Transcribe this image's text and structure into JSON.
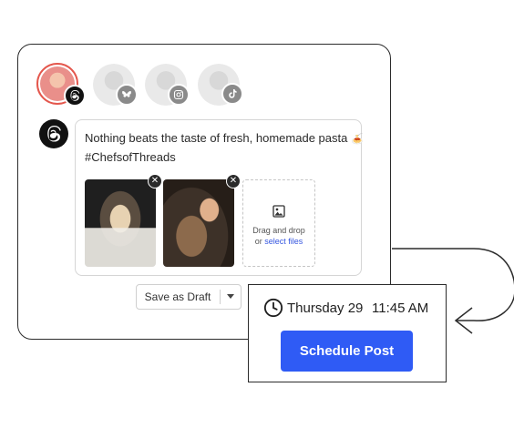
{
  "accounts": [
    {
      "platform": "threads",
      "badge_icon": "threads-icon",
      "selected": true
    },
    {
      "platform": "bluesky",
      "badge_icon": "butterfly-icon",
      "selected": false
    },
    {
      "platform": "instagram",
      "badge_icon": "instagram-icon",
      "selected": false
    },
    {
      "platform": "tiktok",
      "badge_icon": "tiktok-icon",
      "selected": false
    }
  ],
  "composer": {
    "channel_icon": "threads-icon",
    "text_line1": "Nothing beats the taste of fresh, homemade pasta",
    "emoji": "🍝",
    "text_line2": "#ChefsofThreads",
    "attachments": [
      {
        "name": "pasta-hands-photo"
      },
      {
        "name": "pasta-making-photo"
      }
    ],
    "dropzone_line1": "Drag and drop",
    "dropzone_or": "or",
    "dropzone_link": "select files"
  },
  "actions": {
    "save_draft_label": "Save as Draft"
  },
  "schedule": {
    "day": "Thursday 29",
    "time": "11:45 AM",
    "button_label": "Schedule Post"
  },
  "colors": {
    "primary_button": "#2f5bf5",
    "link": "#3556e0",
    "selected_ring": "#e4574d"
  }
}
